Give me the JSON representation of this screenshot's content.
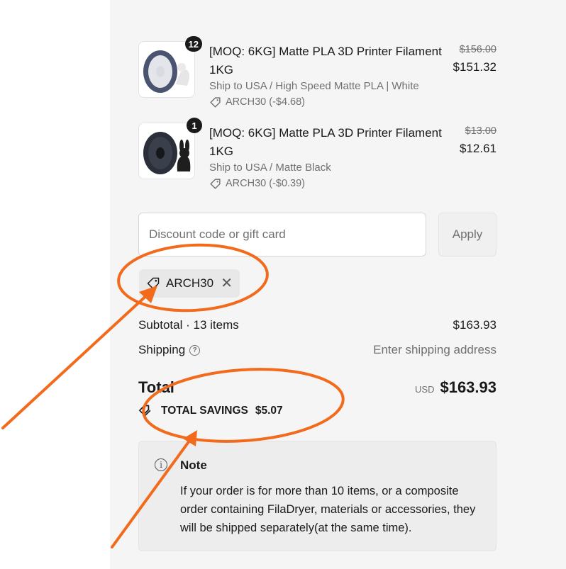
{
  "line_items": [
    {
      "quantity": "12",
      "title": "[MOQ: 6KG] Matte PLA 3D Printer Filament 1KG",
      "variant": "Ship to USA / High Speed Matte PLA | White",
      "discount": "ARCH30 (-$4.68)",
      "original_price": "$156.00",
      "price": "$151.32",
      "spool_color": "#4a5470"
    },
    {
      "quantity": "1",
      "title": "[MOQ: 6KG] Matte PLA 3D Printer Filament 1KG",
      "variant": "Ship to USA / Matte Black",
      "discount": "ARCH30 (-$0.39)",
      "original_price": "$13.00",
      "price": "$12.61",
      "spool_color": "#2b2f3a"
    }
  ],
  "discount_form": {
    "placeholder": "Discount code or gift card",
    "apply_label": "Apply",
    "applied_code": "ARCH30"
  },
  "summary": {
    "subtotal_label": "Subtotal · 13 items",
    "subtotal_value": "$163.93",
    "shipping_label": "Shipping",
    "shipping_value": "Enter shipping address",
    "total_label": "Total",
    "currency": "USD",
    "total_value": "$163.93",
    "savings_label": "TOTAL SAVINGS",
    "savings_value": "$5.07"
  },
  "note": {
    "heading": "Note",
    "body": "If your order is for more than 10 items, or a composite order containing FilaDryer, materials or accessories, they will be shipped separately(at the same time)."
  },
  "annotation_color": "#f26a1b",
  "icons": [
    "tag-icon",
    "help-icon",
    "info-icon",
    "close-icon",
    "savings-tag-icon"
  ]
}
